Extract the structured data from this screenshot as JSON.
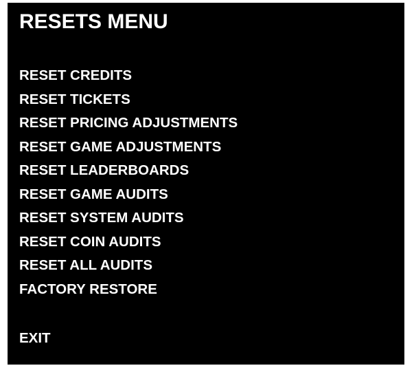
{
  "menu": {
    "title": "RESETS MENU",
    "items": [
      {
        "label": "RESET CREDITS"
      },
      {
        "label": "RESET TICKETS"
      },
      {
        "label": "RESET PRICING ADJUSTMENTS"
      },
      {
        "label": "RESET GAME ADJUSTMENTS"
      },
      {
        "label": "RESET LEADERBOARDS"
      },
      {
        "label": "RESET GAME AUDITS"
      },
      {
        "label": "RESET SYSTEM AUDITS"
      },
      {
        "label": "RESET COIN AUDITS"
      },
      {
        "label": "RESET ALL AUDITS"
      },
      {
        "label": "FACTORY RESTORE"
      }
    ],
    "exit_label": "EXIT"
  },
  "colors": {
    "background": "#000000",
    "text": "#ffffff",
    "page": "#ffffff"
  }
}
